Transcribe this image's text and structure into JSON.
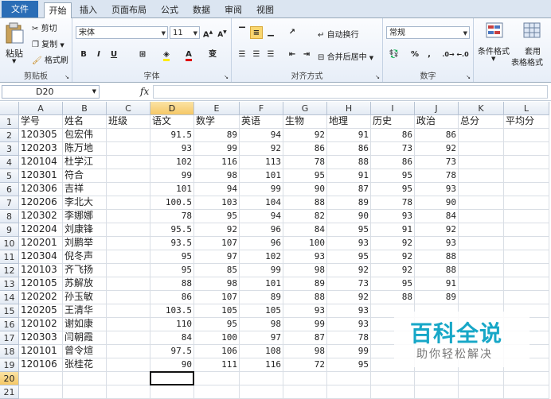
{
  "tabs": [
    "文件",
    "开始",
    "插入",
    "页面布局",
    "公式",
    "数据",
    "审阅",
    "视图"
  ],
  "ribbon": {
    "clipboard": {
      "paste": "粘贴",
      "cut": "剪切",
      "copy": "复制",
      "format_painter": "格式刷",
      "label": "剪贴板"
    },
    "font": {
      "name": "宋体",
      "size": "11",
      "grow": "A",
      "shrink": "A",
      "bold": "B",
      "italic": "I",
      "underline": "U",
      "color_a": "A",
      "phonetic": "变",
      "label": "字体"
    },
    "alignment": {
      "wrap": "自动换行",
      "merge": "合并后居中",
      "label": "对齐方式"
    },
    "number": {
      "format": "常规",
      "percent": "%",
      "comma": ",",
      "label": "数字"
    },
    "styles": {
      "conditional": "条件格式",
      "table": "套用",
      "table2": "表格格式"
    }
  },
  "formula_bar": {
    "name_box": "D20",
    "fx": "fx",
    "formula": ""
  },
  "columns": [
    "A",
    "B",
    "C",
    "D",
    "E",
    "F",
    "G",
    "H",
    "I",
    "J",
    "K",
    "L"
  ],
  "selected_col": "D",
  "selected_row": "20",
  "rows": [
    [
      "学号",
      "姓名",
      "班级",
      "语文",
      "数学",
      "英语",
      "生物",
      "地理",
      "历史",
      "政治",
      "总分",
      "平均分"
    ],
    [
      "120305",
      "包宏伟",
      "",
      "91.5",
      "89",
      "94",
      "92",
      "91",
      "86",
      "86",
      "",
      ""
    ],
    [
      "120203",
      "陈万地",
      "",
      "93",
      "99",
      "92",
      "86",
      "86",
      "73",
      "92",
      "",
      ""
    ],
    [
      "120104",
      "杜学江",
      "",
      "102",
      "116",
      "113",
      "78",
      "88",
      "86",
      "73",
      "",
      ""
    ],
    [
      "120301",
      "符合",
      "",
      "99",
      "98",
      "101",
      "95",
      "91",
      "95",
      "78",
      "",
      ""
    ],
    [
      "120306",
      "吉祥",
      "",
      "101",
      "94",
      "99",
      "90",
      "87",
      "95",
      "93",
      "",
      ""
    ],
    [
      "120206",
      "李北大",
      "",
      "100.5",
      "103",
      "104",
      "88",
      "89",
      "78",
      "90",
      "",
      ""
    ],
    [
      "120302",
      "李娜娜",
      "",
      "78",
      "95",
      "94",
      "82",
      "90",
      "93",
      "84",
      "",
      ""
    ],
    [
      "120204",
      "刘康锋",
      "",
      "95.5",
      "92",
      "96",
      "84",
      "95",
      "91",
      "92",
      "",
      ""
    ],
    [
      "120201",
      "刘鹏举",
      "",
      "93.5",
      "107",
      "96",
      "100",
      "93",
      "92",
      "93",
      "",
      ""
    ],
    [
      "120304",
      "倪冬声",
      "",
      "95",
      "97",
      "102",
      "93",
      "95",
      "92",
      "88",
      "",
      ""
    ],
    [
      "120103",
      "齐飞扬",
      "",
      "95",
      "85",
      "99",
      "98",
      "92",
      "92",
      "88",
      "",
      ""
    ],
    [
      "120105",
      "苏解放",
      "",
      "88",
      "98",
      "101",
      "89",
      "73",
      "95",
      "91",
      "",
      ""
    ],
    [
      "120202",
      "孙玉敏",
      "",
      "86",
      "107",
      "89",
      "88",
      "92",
      "88",
      "89",
      "",
      ""
    ],
    [
      "120205",
      "王清华",
      "",
      "103.5",
      "105",
      "105",
      "93",
      "93",
      "",
      "",
      "",
      ""
    ],
    [
      "120102",
      "谢如康",
      "",
      "110",
      "95",
      "98",
      "99",
      "93",
      "",
      "",
      "",
      ""
    ],
    [
      "120303",
      "闫朝霞",
      "",
      "84",
      "100",
      "97",
      "87",
      "78",
      "",
      "",
      "",
      ""
    ],
    [
      "120101",
      "曾令煊",
      "",
      "97.5",
      "106",
      "108",
      "98",
      "99",
      "",
      "",
      "",
      ""
    ],
    [
      "120106",
      "张桂花",
      "",
      "90",
      "111",
      "116",
      "72",
      "95",
      "",
      "",
      "",
      ""
    ],
    [
      "",
      "",
      "",
      "",
      "",
      "",
      "",
      "",
      "",
      "",
      "",
      ""
    ],
    [
      "",
      "",
      "",
      "",
      "",
      "",
      "",
      "",
      "",
      "",
      "",
      ""
    ]
  ],
  "watermark": {
    "title": "百科全说",
    "subtitle": "助你轻松解决"
  }
}
